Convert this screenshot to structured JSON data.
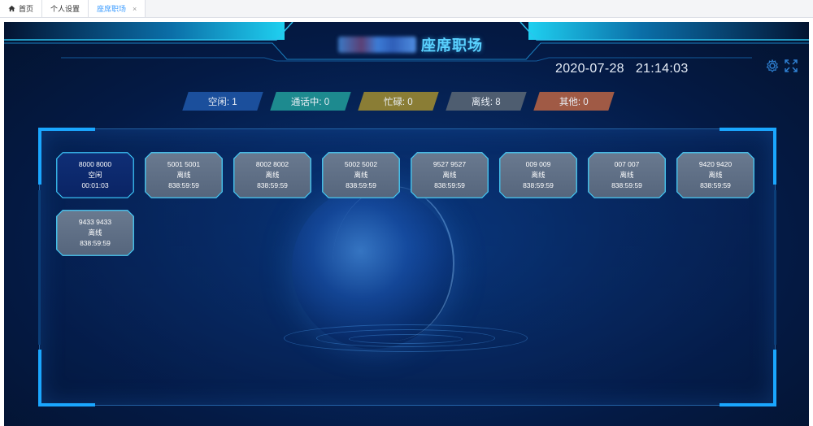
{
  "tabs": [
    {
      "label": "首页",
      "icon": "home-icon",
      "active": false
    },
    {
      "label": "个人设置",
      "active": false
    },
    {
      "label": "座席职场",
      "active": true,
      "close": "×"
    }
  ],
  "header": {
    "title": "座席职场",
    "date": "2020-07-28",
    "time": "21:14:03",
    "icons": [
      "settings-icon",
      "fullscreen-icon"
    ]
  },
  "status": [
    {
      "label": "空闲: 1",
      "color": "#1b4f9c"
    },
    {
      "label": "通话中: 0",
      "color": "#1d8a8f"
    },
    {
      "label": "忙碌: 0",
      "color": "#8a7d35"
    },
    {
      "label": "离线: 8",
      "color": "#4e5d70"
    },
    {
      "label": "其他: 0",
      "color": "#a05a45"
    }
  ],
  "seats": [
    {
      "name": "8000 8000",
      "state": "空闲",
      "duration": "00:01:03",
      "kind": "idle"
    },
    {
      "name": "5001 5001",
      "state": "离线",
      "duration": "838:59:59",
      "kind": "offline"
    },
    {
      "name": "8002 8002",
      "state": "离线",
      "duration": "838:59:59",
      "kind": "offline"
    },
    {
      "name": "5002 5002",
      "state": "离线",
      "duration": "838:59:59",
      "kind": "offline"
    },
    {
      "name": "9527 9527",
      "state": "离线",
      "duration": "838:59:59",
      "kind": "offline"
    },
    {
      "name": "009 009",
      "state": "离线",
      "duration": "838:59:59",
      "kind": "offline"
    },
    {
      "name": "007 007",
      "state": "离线",
      "duration": "838:59:59",
      "kind": "offline"
    },
    {
      "name": "9420 9420",
      "state": "离线",
      "duration": "838:59:59",
      "kind": "offline"
    },
    {
      "name": "9433 9433",
      "state": "离线",
      "duration": "838:59:59",
      "kind": "offline"
    }
  ]
}
